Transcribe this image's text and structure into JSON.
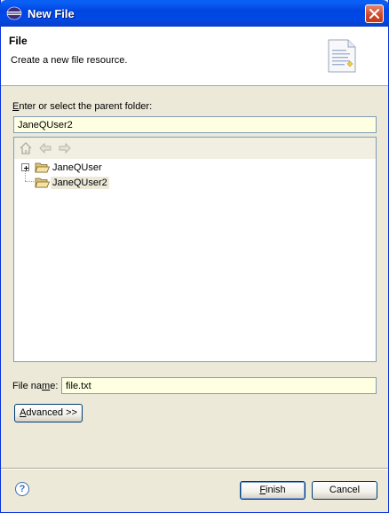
{
  "window": {
    "title": "New File"
  },
  "banner": {
    "title": "File",
    "description": "Create a new file resource."
  },
  "parent_folder": {
    "label_accel": "E",
    "label_rest": "nter or select the parent folder:",
    "value": "JaneQUser2"
  },
  "tree": {
    "toolbar": [
      "home-icon",
      "back-arrow-icon",
      "forward-arrow-icon"
    ],
    "nodes": [
      {
        "label": "JaneQUser",
        "expandable": true,
        "selected": false
      },
      {
        "label": "JaneQUser2",
        "expandable": false,
        "selected": true
      }
    ]
  },
  "file_name": {
    "label_before": "File na",
    "label_accel": "m",
    "label_after": "e:",
    "value": "file.txt"
  },
  "advanced_button": {
    "accel": "A",
    "rest": "dvanced >>"
  },
  "footer": {
    "help_glyph": "?",
    "finish": {
      "accel": "F",
      "rest": "inish"
    },
    "cancel": "Cancel"
  },
  "colors": {
    "field_bg": "#FFFFE1",
    "title_bar": "#0049E8",
    "dialog_bg": "#ECE9D8"
  }
}
